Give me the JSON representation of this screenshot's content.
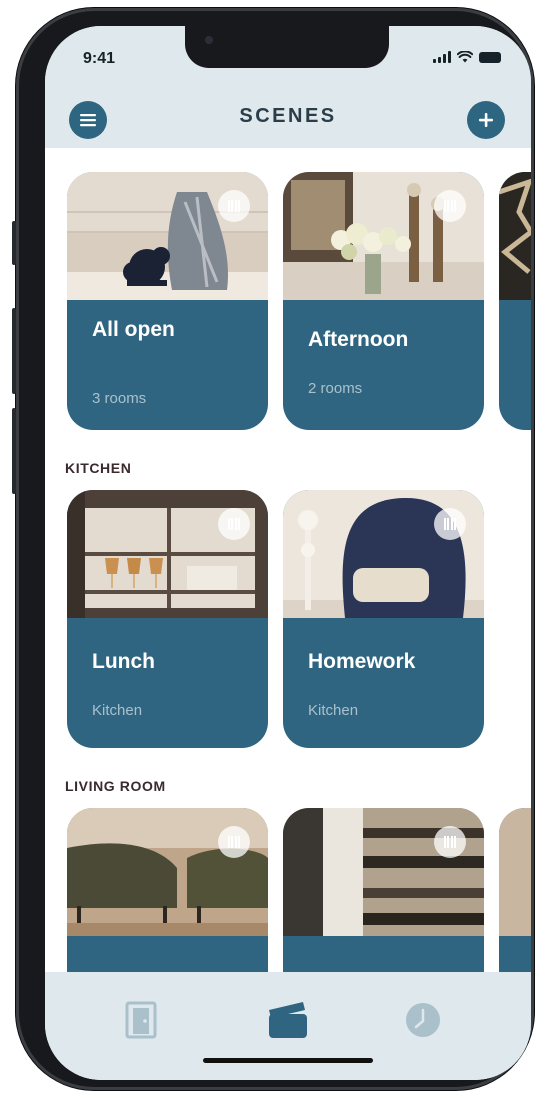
{
  "status_bar": {
    "time": "9:41"
  },
  "header": {
    "title": "SCENES",
    "menu_icon": "hamburger-menu-icon",
    "add_icon": "plus-icon"
  },
  "sections": [
    {
      "label": "",
      "scenes": [
        {
          "name": "All open",
          "subtitle": "3 rooms",
          "icon": "curtains-icon"
        },
        {
          "name": "Afternoon",
          "subtitle": "2 rooms",
          "icon": "curtains-icon"
        },
        {
          "name": "",
          "subtitle": "",
          "icon": ""
        }
      ]
    },
    {
      "label": "KITCHEN",
      "scenes": [
        {
          "name": "Lunch",
          "subtitle": "Kitchen",
          "icon": "curtains-icon"
        },
        {
          "name": "Homework",
          "subtitle": "Kitchen",
          "icon": "curtains-icon"
        }
      ]
    },
    {
      "label": "LIVING ROOM",
      "scenes": [
        {
          "name": "",
          "subtitle": "",
          "icon": "curtains-icon"
        },
        {
          "name": "",
          "subtitle": "",
          "icon": "curtains-icon"
        },
        {
          "name": "",
          "subtitle": "",
          "icon": ""
        }
      ]
    }
  ],
  "tab_bar": {
    "tabs": [
      {
        "id": "rooms",
        "icon": "door-icon",
        "active": false
      },
      {
        "id": "scenes",
        "icon": "scenes-card-icon",
        "active": true
      },
      {
        "id": "schedules",
        "icon": "clock-icon",
        "active": false
      }
    ]
  },
  "colors": {
    "accent": "#2f6580",
    "header_bg": "#dfe8ec",
    "title_text": "#2b3d48",
    "section_label": "#3a2a2e",
    "subtitle_text": "#a9c1cc"
  }
}
